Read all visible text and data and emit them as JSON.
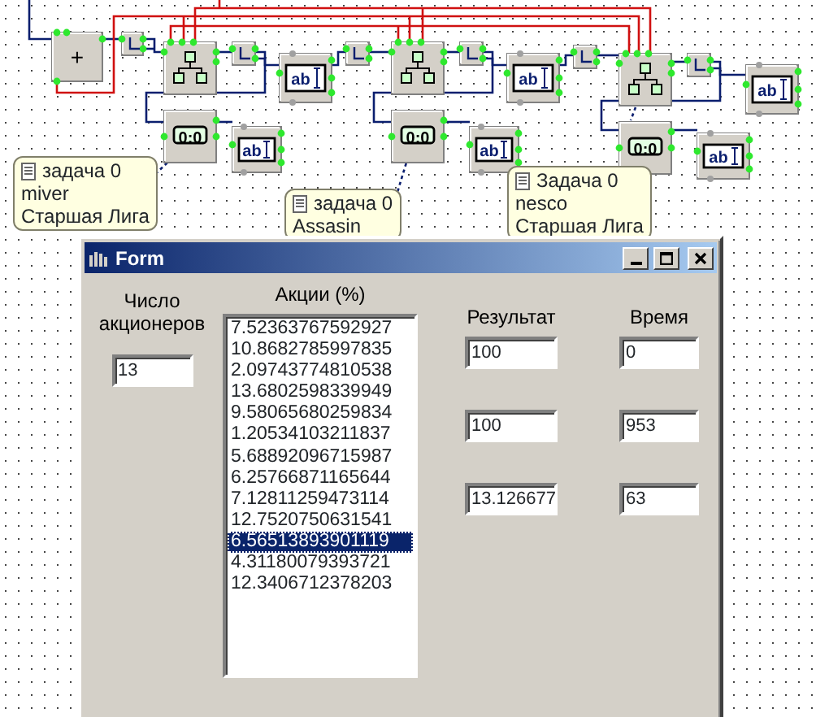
{
  "canvas": {
    "blocks": [
      {
        "kind": "adder",
        "label": "+"
      },
      {
        "kind": "splitter"
      },
      {
        "kind": "branch"
      },
      {
        "kind": "splitter"
      },
      {
        "kind": "edit",
        "label": "ab"
      },
      {
        "kind": "timer",
        "label": "0:0"
      },
      {
        "kind": "edit",
        "label": "ab"
      },
      {
        "kind": "splitter"
      },
      {
        "kind": "branch"
      },
      {
        "kind": "splitter"
      },
      {
        "kind": "edit",
        "label": "ab"
      },
      {
        "kind": "timer",
        "label": "0:0"
      },
      {
        "kind": "edit",
        "label": "ab"
      },
      {
        "kind": "splitter"
      },
      {
        "kind": "branch"
      },
      {
        "kind": "splitter"
      },
      {
        "kind": "edit",
        "label": "ab"
      },
      {
        "kind": "timer",
        "label": "0:0"
      },
      {
        "kind": "edit",
        "label": "ab"
      }
    ],
    "notes": [
      {
        "lines": [
          "задача 0",
          "miver",
          "Старшая Лига"
        ]
      },
      {
        "lines": [
          "задача 0",
          "Assasin"
        ]
      },
      {
        "lines": [
          "Задача 0",
          "nesco",
          "Старшая Лига"
        ]
      }
    ]
  },
  "form": {
    "title": "Form",
    "holders_label": [
      "Число",
      "акционеров"
    ],
    "holders_value": "13",
    "shares_label": "Акции (%)",
    "shares": [
      {
        "text": "7.52363767592927",
        "selected": false
      },
      {
        "text": "10.8682785997835",
        "selected": false
      },
      {
        "text": "2.09743774810538",
        "selected": false
      },
      {
        "text": "13.6802598339949",
        "selected": false
      },
      {
        "text": "9.58065680259834",
        "selected": false
      },
      {
        "text": "1.20534103211837",
        "selected": false
      },
      {
        "text": "5.68892096715987",
        "selected": false
      },
      {
        "text": "6.25766871165644",
        "selected": false
      },
      {
        "text": "7.12811259473114",
        "selected": false
      },
      {
        "text": "12.7520750631541",
        "selected": false
      },
      {
        "text": "6.56513893901119",
        "selected": true
      },
      {
        "text": "4.31180079393721",
        "selected": false
      },
      {
        "text": "12.3406712378203",
        "selected": false
      }
    ],
    "result_label": "Результат",
    "time_label": "Время",
    "rows": [
      {
        "result": "100",
        "time": "0"
      },
      {
        "result": "100",
        "time": "953"
      },
      {
        "result": "13.126677",
        "time": "63"
      }
    ]
  }
}
